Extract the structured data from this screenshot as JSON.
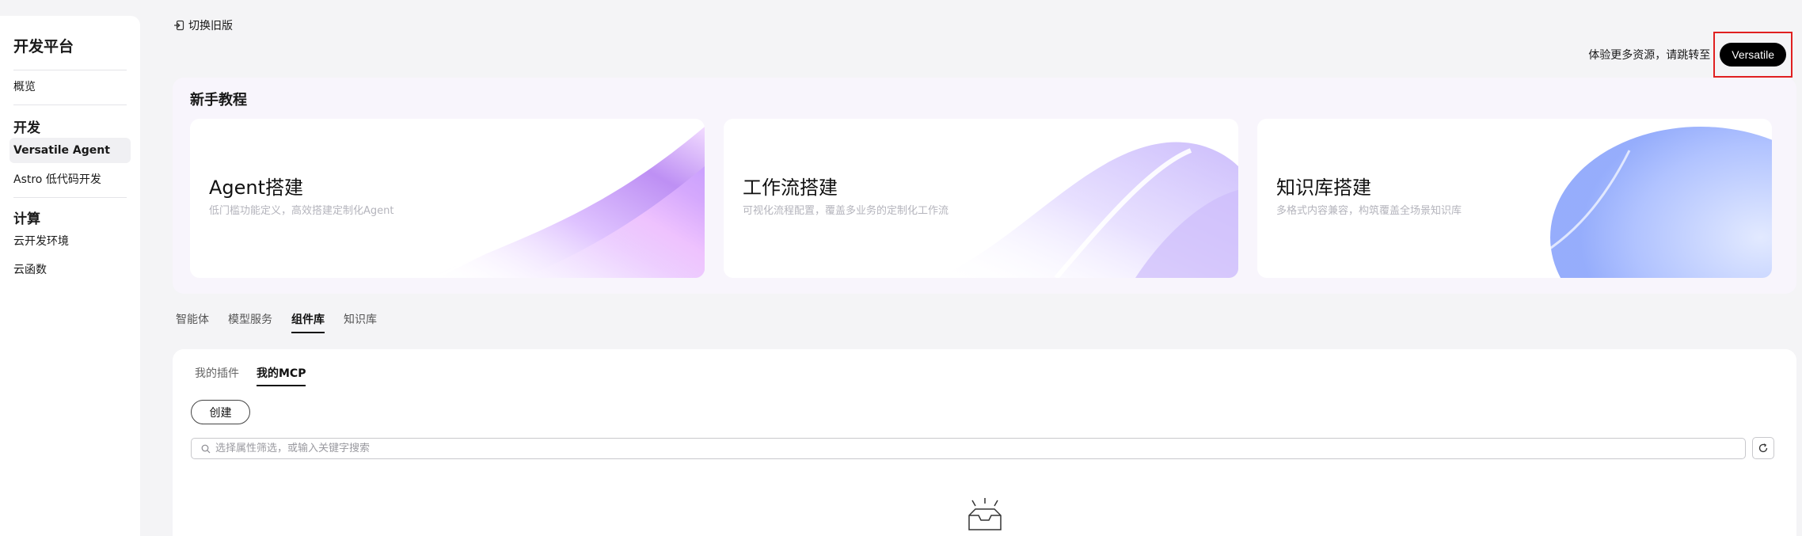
{
  "sidebar": {
    "brand": "开发平台",
    "overview": "概览",
    "groups": [
      {
        "title": "开发",
        "items": [
          "Versatile Agent",
          "Astro 低代码开发"
        ]
      },
      {
        "title": "计算",
        "items": [
          "云开发环境",
          "云函数"
        ]
      }
    ]
  },
  "topbar": {
    "old_version": "切换旧版",
    "promo_text": "体验更多资源，请跳转至",
    "versatile_btn": "Versatile"
  },
  "tutorial": {
    "title": "新手教程",
    "cards": [
      {
        "title": "Agent搭建",
        "subtitle": "低门槛功能定义，高效搭建定制化Agent"
      },
      {
        "title": "工作流搭建",
        "subtitle": "可视化流程配置，覆盖多业务的定制化工作流"
      },
      {
        "title": "知识库搭建",
        "subtitle": "多格式内容兼容，构筑覆盖全场景知识库"
      }
    ]
  },
  "main_tabs": [
    "智能体",
    "模型服务",
    "组件库",
    "知识库"
  ],
  "content": {
    "sub_tabs": [
      "我的插件",
      "我的MCP"
    ],
    "create_btn": "创建",
    "search_placeholder": "选择属性筛选，或输入关键字搜索"
  },
  "colors": {
    "accent": "#000000",
    "highlight_frame": "#e02020",
    "page_bg": "#f4f4f6"
  },
  "icons": {
    "old_version": "exit-icon",
    "search": "search-icon",
    "refresh": "refresh-icon",
    "empty": "empty-box-icon"
  }
}
